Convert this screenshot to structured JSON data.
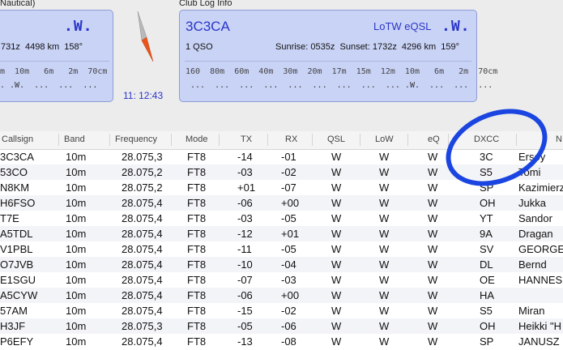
{
  "left_panel": {
    "title": "Nautical)",
    "big_w": ".W.",
    "info": "731z  4498 km  158°",
    "bands": "m  10m   6m   2m  70cm",
    "dots": ". .W.  ...  ...  ..."
  },
  "clock": "11: 12:43",
  "club_panel": {
    "title": "Club Log Info",
    "callsign": "3C3CA",
    "lotw_eqsl": "LoTW eQSL",
    "big_w": ".W.",
    "qso": "1 QSO",
    "sun_info": "Sunrise: 0535z  Sunset: 1732z  4296 km  159°",
    "bands": "160  80m  60m  40m  30m  20m  17m  15m  12m  10m   6m   2m  70cm",
    "dots": " ...  ...  ...  ...  ...  ...  ...  ...  ... .W.  ...  ...  ..."
  },
  "table": {
    "headers": [
      "Callsign",
      "Band",
      "Frequency",
      "Mode",
      "TX",
      "RX",
      "QSL",
      "LoW",
      "eQ",
      "DXCC",
      "N"
    ],
    "rows": [
      {
        "call": "3C3CA",
        "band": "10m",
        "freq": "28.075,3",
        "mode": "FT8",
        "tx": "-14",
        "rx": "-01",
        "qsl": "W",
        "lotw": "W",
        "eq": "W",
        "dxcc": "3C",
        "name": "Ersoy"
      },
      {
        "call": "53CO",
        "band": "10m",
        "freq": "28.075,2",
        "mode": "FT8",
        "tx": "-03",
        "rx": "-02",
        "qsl": "W",
        "lotw": "W",
        "eq": "W",
        "dxcc": "S5",
        "name": "Tomi"
      },
      {
        "call": "N8KM",
        "band": "10m",
        "freq": "28.075,2",
        "mode": "FT8",
        "tx": "+01",
        "rx": "-07",
        "qsl": "W",
        "lotw": "W",
        "eq": "W",
        "dxcc": "SP",
        "name": "Kazimierz"
      },
      {
        "call": "H6FSO",
        "band": "10m",
        "freq": "28.075,4",
        "mode": "FT8",
        "tx": "-06",
        "rx": "+00",
        "qsl": "W",
        "lotw": "W",
        "eq": "W",
        "dxcc": "OH",
        "name": "Jukka"
      },
      {
        "call": "T7E",
        "band": "10m",
        "freq": "28.075,4",
        "mode": "FT8",
        "tx": "-03",
        "rx": "-05",
        "qsl": "W",
        "lotw": "W",
        "eq": "W",
        "dxcc": "YT",
        "name": "Sandor"
      },
      {
        "call": "A5TDL",
        "band": "10m",
        "freq": "28.075,4",
        "mode": "FT8",
        "tx": "-12",
        "rx": "+01",
        "qsl": "W",
        "lotw": "W",
        "eq": "W",
        "dxcc": "9A",
        "name": "Dragan"
      },
      {
        "call": "V1PBL",
        "band": "10m",
        "freq": "28.075,4",
        "mode": "FT8",
        "tx": "-11",
        "rx": "-05",
        "qsl": "W",
        "lotw": "W",
        "eq": "W",
        "dxcc": "SV",
        "name": "GEORGE"
      },
      {
        "call": "O7JVB",
        "band": "10m",
        "freq": "28.075,4",
        "mode": "FT8",
        "tx": "-10",
        "rx": "-04",
        "qsl": "W",
        "lotw": "W",
        "eq": "W",
        "dxcc": "DL",
        "name": "Bernd"
      },
      {
        "call": "E1SGU",
        "band": "10m",
        "freq": "28.075,4",
        "mode": "FT8",
        "tx": "-07",
        "rx": "-03",
        "qsl": "W",
        "lotw": "W",
        "eq": "W",
        "dxcc": "OE",
        "name": "HANNES"
      },
      {
        "call": "A5CYW",
        "band": "10m",
        "freq": "28.075,4",
        "mode": "FT8",
        "tx": "-06",
        "rx": "+00",
        "qsl": "W",
        "lotw": "W",
        "eq": "W",
        "dxcc": "HA",
        "name": ""
      },
      {
        "call": "57AM",
        "band": "10m",
        "freq": "28.075,4",
        "mode": "FT8",
        "tx": "-15",
        "rx": "-02",
        "qsl": "W",
        "lotw": "W",
        "eq": "W",
        "dxcc": "S5",
        "name": "Miran"
      },
      {
        "call": "H3JF",
        "band": "10m",
        "freq": "28.075,3",
        "mode": "FT8",
        "tx": "-05",
        "rx": "-06",
        "qsl": "W",
        "lotw": "W",
        "eq": "W",
        "dxcc": "OH",
        "name": "Heikki \"H"
      },
      {
        "call": "P6EFY",
        "band": "10m",
        "freq": "28.075,4",
        "mode": "FT8",
        "tx": "-13",
        "rx": "-08",
        "qsl": "W",
        "lotw": "W",
        "eq": "W",
        "dxcc": "SP",
        "name": "JANUSZ"
      }
    ]
  },
  "colors": {
    "accent": "#2a35c8",
    "panel": "#c9d3f6",
    "annotation": "#1b45e0"
  }
}
